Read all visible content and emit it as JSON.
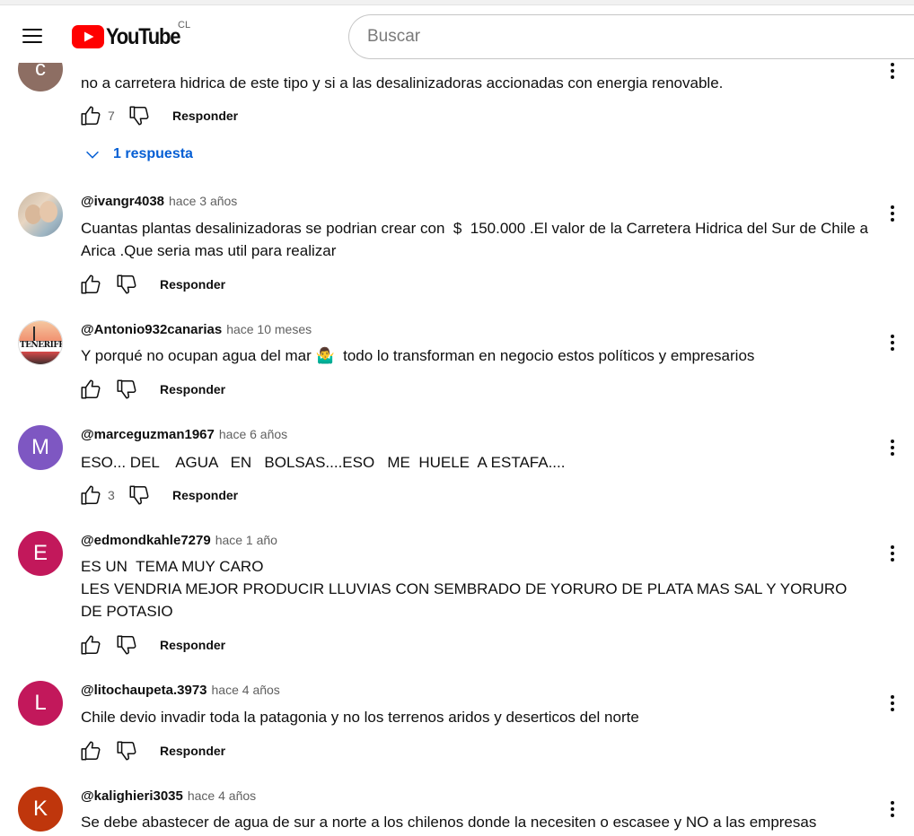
{
  "header": {
    "logo_text": "YouTube",
    "country": "CL",
    "search_placeholder": "Buscar"
  },
  "colors": {
    "brand_red": "#ff0000",
    "link_blue": "#065fd4",
    "avatar_c": "#8d6e63",
    "avatar_m": "#7e57c2",
    "avatar_e": "#c2185b",
    "avatar_l": "#c2185b",
    "avatar_k": "#bf360c"
  },
  "labels": {
    "reply": "Responder"
  },
  "comments": [
    {
      "avatar_letter": "c",
      "text": "no a carretera hidrica de este tipo y si a las desalinizadoras accionadas con energia renovable.",
      "likes": "7",
      "replies_label": "1 respuesta"
    },
    {
      "handle": "@ivangr4038",
      "time": "hace 3 años",
      "text": "Cuantas plantas desalinizadoras se podrian crear con  $  150.000 .El valor de la Carretera Hidrica del Sur de Chile a Arica .Que seria mas util para realizar",
      "likes": ""
    },
    {
      "handle": "@Antonio932canarias",
      "time": "hace 10 meses",
      "avatar_text": "TENERIFE",
      "text": "Y porqué no ocupan agua del mar 🤷‍♂️  todo lo transforman en negocio estos políticos y empresarios",
      "likes": ""
    },
    {
      "handle": "@marceguzman1967",
      "time": "hace 6 años",
      "avatar_letter": "M",
      "text": "ESO... DEL    AGUA   EN   BOLSAS....ESO   ME  HUELE  A ESTAFA....",
      "likes": "3"
    },
    {
      "handle": "@edmondkahle7279",
      "time": "hace 1 año",
      "avatar_letter": "E",
      "text": "ES UN  TEMA MUY CARO\nLES VENDRIA MEJOR PRODUCIR LLUVIAS CON SEMBRADO DE YORURO DE PLATA MAS SAL Y YORURO DE POTASIO",
      "likes": ""
    },
    {
      "handle": "@litochaupeta.3973",
      "time": "hace 4 años",
      "avatar_letter": "L",
      "text": "Chile devio invadir toda la patagonia y no los terrenos aridos y deserticos del norte",
      "likes": ""
    },
    {
      "handle": "@kalighieri3035",
      "time": "hace 4 años",
      "avatar_letter": "K",
      "text": "Se debe abastecer de agua de sur a norte a los chilenos donde la necesiten o escasee y NO a las empresas",
      "likes": ""
    }
  ]
}
